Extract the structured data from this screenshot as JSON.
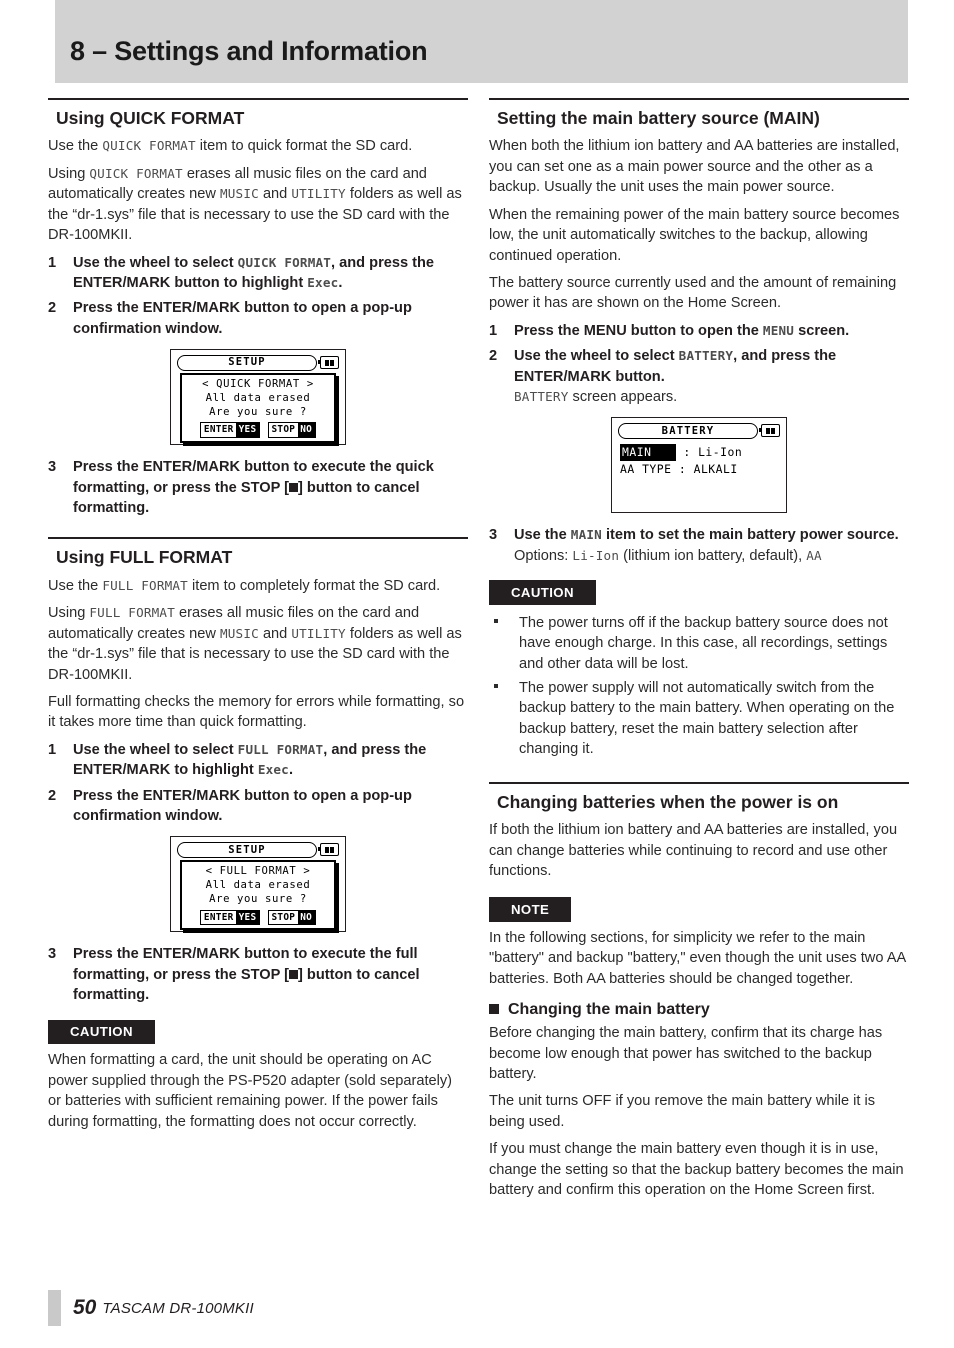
{
  "header": {
    "title": "8 – Settings and Information",
    "band_color": "#d2d2d2"
  },
  "footer": {
    "page_number": "50",
    "product": "TASCAM DR-100MKII"
  },
  "left_column": {
    "quick_format": {
      "heading": "Using QUICK FORMAT",
      "p1_a": "Use the ",
      "p1_mono": "QUICK FORMAT",
      "p1_b": " item to quick format the SD card.",
      "p2_a": "Using ",
      "p2_mono1": "QUICK FORMAT",
      "p2_b": " erases all music files on the card and automatically creates new ",
      "p2_mono2": "MUSIC",
      "p2_c": " and ",
      "p2_mono3": "UTILITY",
      "p2_d": " folders as well as the “dr-1.sys” file that is necessary to use the SD card with the DR-100MKII.",
      "step1_num": "1",
      "step1_a": "Use the wheel to select ",
      "step1_mono1": "QUICK FORMAT",
      "step1_b": ", and press the ENTER/MARK button to highlight ",
      "step1_mono2": "Exec",
      "step1_c": ".",
      "step2_num": "2",
      "step2_text": "Press the ENTER/MARK button to open a pop-up confirmation window.",
      "step3_num": "3",
      "step3_a": "Press the ENTER/MARK button to execute the quick formatting, or press the STOP [",
      "step3_b": "] button to cancel formatting.",
      "lcd": {
        "title": "SETUP",
        "line1": "< QUICK FORMAT >",
        "line2": "All data erased",
        "line3": "Are you sure ?",
        "btn1_key": "ENTER",
        "btn1_val": "YES",
        "btn2_key": "STOP",
        "btn2_val": "NO"
      }
    },
    "full_format": {
      "heading": "Using FULL FORMAT",
      "p1_a": "Use the ",
      "p1_mono": "FULL FORMAT",
      "p1_b": " item to completely format the SD card.",
      "p2_a": "Using ",
      "p2_mono1": "FULL FORMAT",
      "p2_b": " erases all music files on the card and automatically creates new ",
      "p2_mono2": "MUSIC",
      "p2_c": " and ",
      "p2_mono3": "UTILITY",
      "p2_d": " folders as well as the “dr-1.sys” file that is necessary to use the SD card with the DR-100MKII.",
      "p3": "Full formatting checks the memory for errors while formatting, so it takes more time than quick formatting.",
      "step1_num": "1",
      "step1_a": "Use the wheel to select ",
      "step1_mono1": "FULL FORMAT",
      "step1_b": ", and press the ENTER/MARK to highlight ",
      "step1_mono2": "Exec",
      "step1_c": ".",
      "step2_num": "2",
      "step2_text": "Press the ENTER/MARK button to open a pop-up confirmation window.",
      "step3_num": "3",
      "step3_a": "Press the ENTER/MARK button to execute the full formatting, or press the STOP [",
      "step3_b": "] button to cancel formatting.",
      "lcd": {
        "title": "SETUP",
        "line1": "< FULL FORMAT >",
        "line2": "All data erased",
        "line3": "Are you sure ?",
        "btn1_key": "ENTER",
        "btn1_val": "YES",
        "btn2_key": "STOP",
        "btn2_val": "NO"
      },
      "caution_tag": "CAUTION",
      "caution_text": "When formatting a card, the unit should be operating on AC power supplied through the PS-P520 adapter (sold separately) or batteries with sufficient remaining power. If the power fails during formatting, the formatting does not occur correctly."
    }
  },
  "right_column": {
    "main_battery": {
      "heading": "Setting the main battery source (MAIN)",
      "p1": "When both the lithium ion battery and AA batteries are installed, you can set one as a main power source and the other as a backup. Usually the unit uses the main power source.",
      "p2": "When the remaining power of the main battery source becomes low, the unit automatically switches to the backup, allowing continued operation.",
      "p3": "The battery source currently used and the amount of remaining power it has are shown on the Home Screen.",
      "step1_num": "1",
      "step1_a": "Press the MENU button to open the ",
      "step1_mono": "MENU",
      "step1_b": " screen.",
      "step2_num": "2",
      "step2_a": "Use the wheel to select ",
      "step2_mono": "BATTERY",
      "step2_b": ", and press the ENTER/MARK button.",
      "step2_sub_mono": "BATTERY",
      "step2_sub_text": " screen appears.",
      "lcd": {
        "title": "BATTERY",
        "row1_label": "MAIN",
        "row1_value": ": Li-Ion",
        "row2_label": "AA TYPE",
        "row2_value": ": ALKALI"
      },
      "step3_num": "3",
      "step3_a": "Use the ",
      "step3_mono": "MAIN",
      "step3_b": " item to set the main battery power source.",
      "options_label": "Options: ",
      "options_mono1": "Li-Ion",
      "options_mid": " (lithium ion battery, default), ",
      "options_mono2": "AA",
      "caution_tag": "CAUTION",
      "caution_bullets": [
        "The power turns off if the backup battery source does not have enough charge. In this case, all recordings, settings and other data will be lost.",
        "The power supply will not automatically switch from the backup battery to the main battery. When operating on the backup battery, reset the main battery selection after changing it."
      ]
    },
    "changing_batteries": {
      "heading": "Changing batteries when the power is on",
      "p1": "If both the lithium ion battery and AA batteries are installed, you can change batteries while continuing to record and use other functions.",
      "note_tag": "NOTE",
      "note_text": "In the following sections, for simplicity we refer to the main \"battery\" and backup \"battery,\" even though the unit uses two AA batteries. Both AA batteries should be changed together.",
      "subhead": "Changing the main battery",
      "p2": "Before changing the main battery, confirm that its charge has become low enough that power has switched to the backup battery.",
      "p3": "The unit turns OFF if you remove the main battery while it is being used.",
      "p4": "If you must change the main battery even though it is in use, change the setting so that the backup battery becomes the main battery and confirm this operation on the Home Screen first."
    }
  }
}
